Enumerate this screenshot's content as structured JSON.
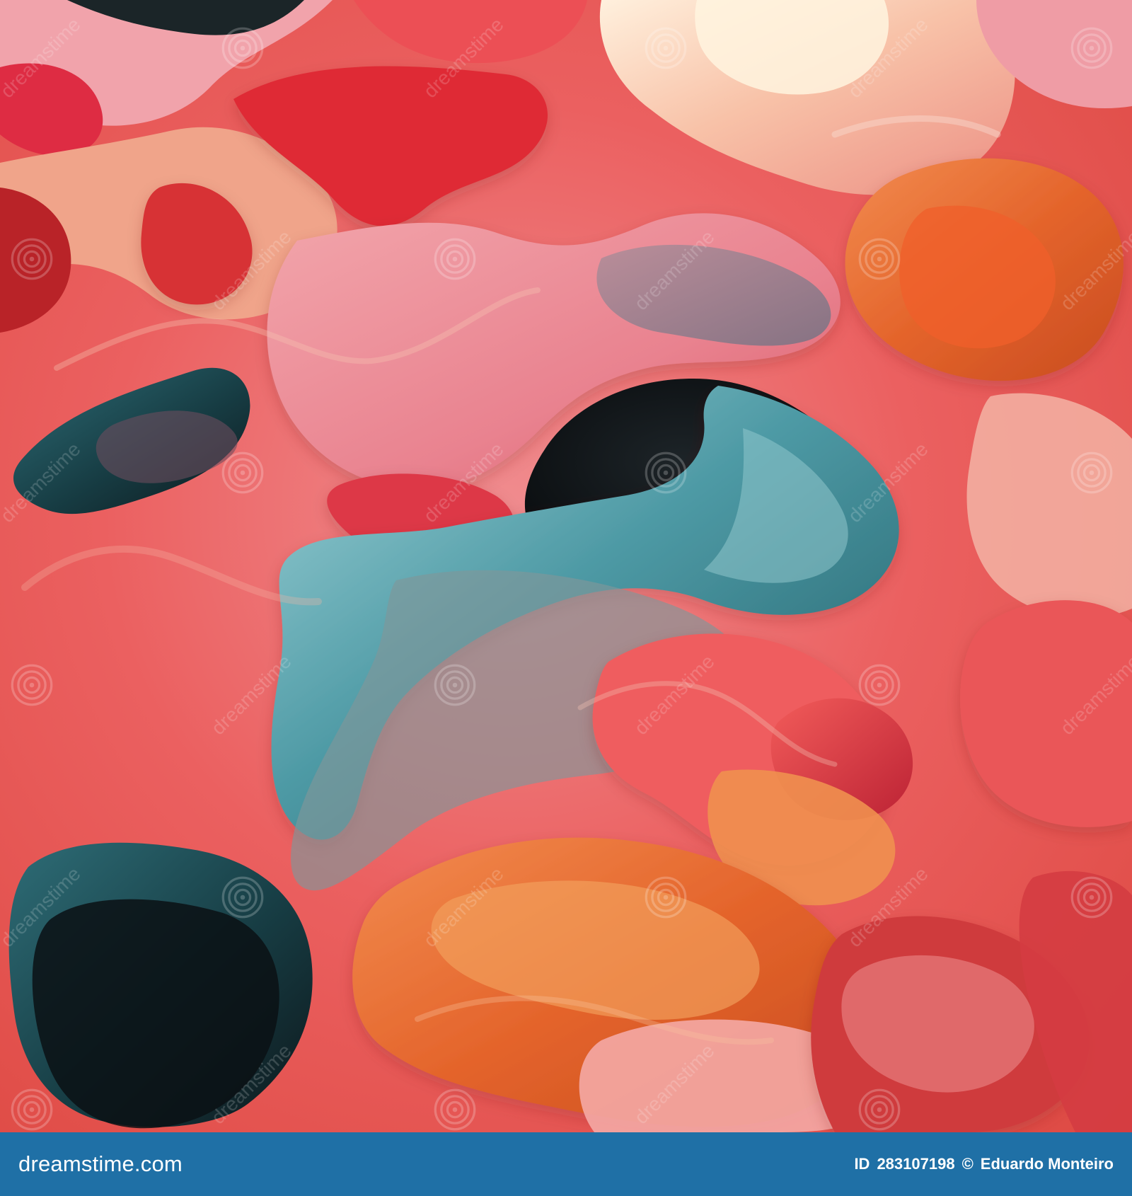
{
  "image": {
    "subject": "",
    "palette": {
      "coral": "#ea5f5f",
      "pink": "#e98a97",
      "orange": "#e46a2d",
      "peach": "#f5b08f",
      "teal": "#4d97a3",
      "dark_teal": "#1d4b54",
      "black": "#111417"
    }
  },
  "watermark": {
    "icon": "spiral-icon",
    "text": "dreamstime"
  },
  "footer": {
    "brand": "dreamstime.com",
    "id_prefix": "ID",
    "id_number": "283107198",
    "copyright": "©",
    "author": "Eduardo Monteiro",
    "background": "#1f70a6",
    "text_color": "#ffffff"
  }
}
